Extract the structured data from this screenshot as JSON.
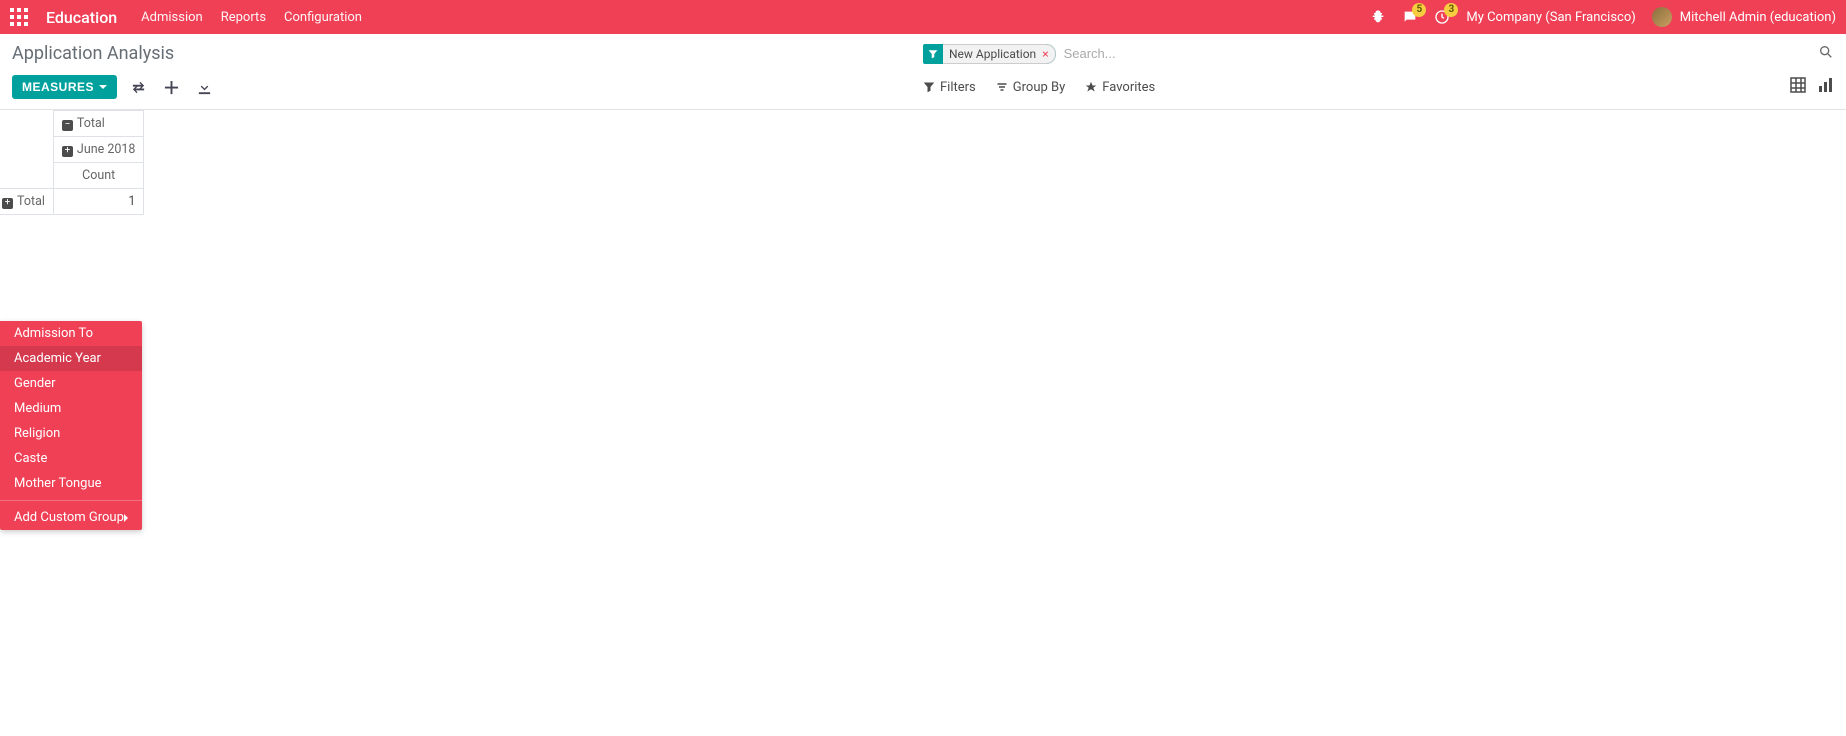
{
  "navbar": {
    "app_title": "Education",
    "links": [
      "Admission",
      "Reports",
      "Configuration"
    ],
    "chat_badge": "5",
    "activity_badge": "3",
    "company": "My Company (San Francisco)",
    "user": "Mitchell Admin (education)"
  },
  "control": {
    "page_title": "Application Analysis",
    "facet_label": "New Application",
    "search_placeholder": "Search...",
    "measures_btn": "MEASURES",
    "filters_label": "Filters",
    "groupby_label": "Group By",
    "favorites_label": "Favorites"
  },
  "pivot": {
    "total_label": "Total",
    "month_label": "June 2018",
    "count_label": "Count",
    "row_total_label": "Total",
    "value": "1"
  },
  "dropdown": {
    "items": [
      "Admission To",
      "Academic Year",
      "Gender",
      "Medium",
      "Religion",
      "Caste",
      "Mother Tongue"
    ],
    "hovered_index": 1,
    "custom_group": "Add Custom Group"
  }
}
